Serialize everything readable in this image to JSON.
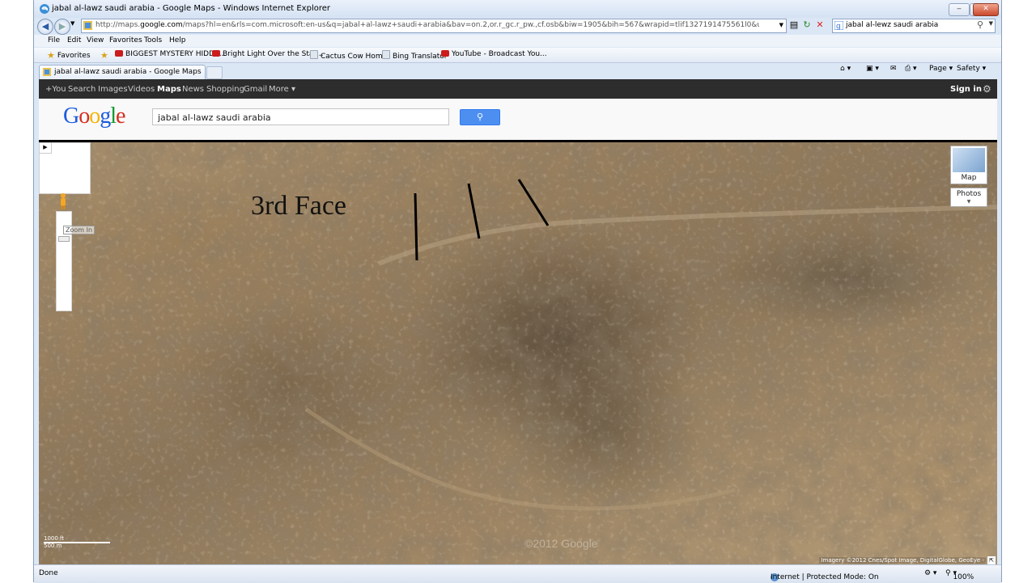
{
  "window": {
    "title": "jabal al-lawz saudi arabia - Google Maps - Windows Internet Explorer",
    "minimize": "‒",
    "maximize": "□",
    "close": "✕"
  },
  "address": {
    "url_prefix": "http://maps.",
    "url_domain": "google.com",
    "url_rest": "/maps?hl=en&rls=com.microsoft:en-us&q=jabal+al-lawz+saudi+arabia&bav=on.2,or.r_gc.r_pw.,cf.osb&biw=1905&bih=567&wrapid=tlif1327191475561l0&um=1&ie=UTF-8&ei=z1UbT7-al4zWiAKtmbzBCA",
    "search_text": "jabal al-lewz saudi arabia"
  },
  "menu": [
    "File",
    "Edit",
    "View",
    "Favorites",
    "Tools",
    "Help"
  ],
  "favorites": {
    "label": "Favorites",
    "items": [
      {
        "label": "BIGGEST MYSTERY HIDDE...",
        "icon": "youtube-icon"
      },
      {
        "label": "Bright Light Over the Stat...",
        "icon": "youtube-icon"
      },
      {
        "label": "Cactus Cow  Home",
        "icon": "page-icon"
      },
      {
        "label": "Bing Translator",
        "icon": "page-icon"
      },
      {
        "label": "YouTube - Broadcast You...",
        "icon": "youtube-icon"
      }
    ]
  },
  "tab": {
    "label": "jabal al-lawz saudi arabia - Google Maps"
  },
  "command_bar": {
    "page": "Page ▾",
    "safety": "Safety ▾"
  },
  "google_bar": {
    "items": [
      "+You",
      "Search",
      "Images",
      "Videos",
      "Maps",
      "News",
      "Shopping",
      "Gmail",
      "More ▾"
    ],
    "active": "Maps",
    "signin": "Sign in"
  },
  "google_header": {
    "logo": "Google",
    "query": "jabal al-lawz saudi arabia"
  },
  "map": {
    "annotation": "3rd Face",
    "zoom_tooltip": "Zoom In",
    "map_type_label": "Map",
    "photos_label": "Photos",
    "scale_top": "1000 ft",
    "scale_bottom": "500 m",
    "attribution": "Imagery ©2012 Cnes/Spot Image, DigitalGlobe, GeoEye -",
    "watermark": "©2012 Google",
    "colors": {
      "terrain": "#967d5c",
      "annotation_lines": "#000000"
    }
  },
  "status": {
    "left": "Done",
    "zone": "Internet | Protected Mode: On",
    "zoom": "100%"
  }
}
